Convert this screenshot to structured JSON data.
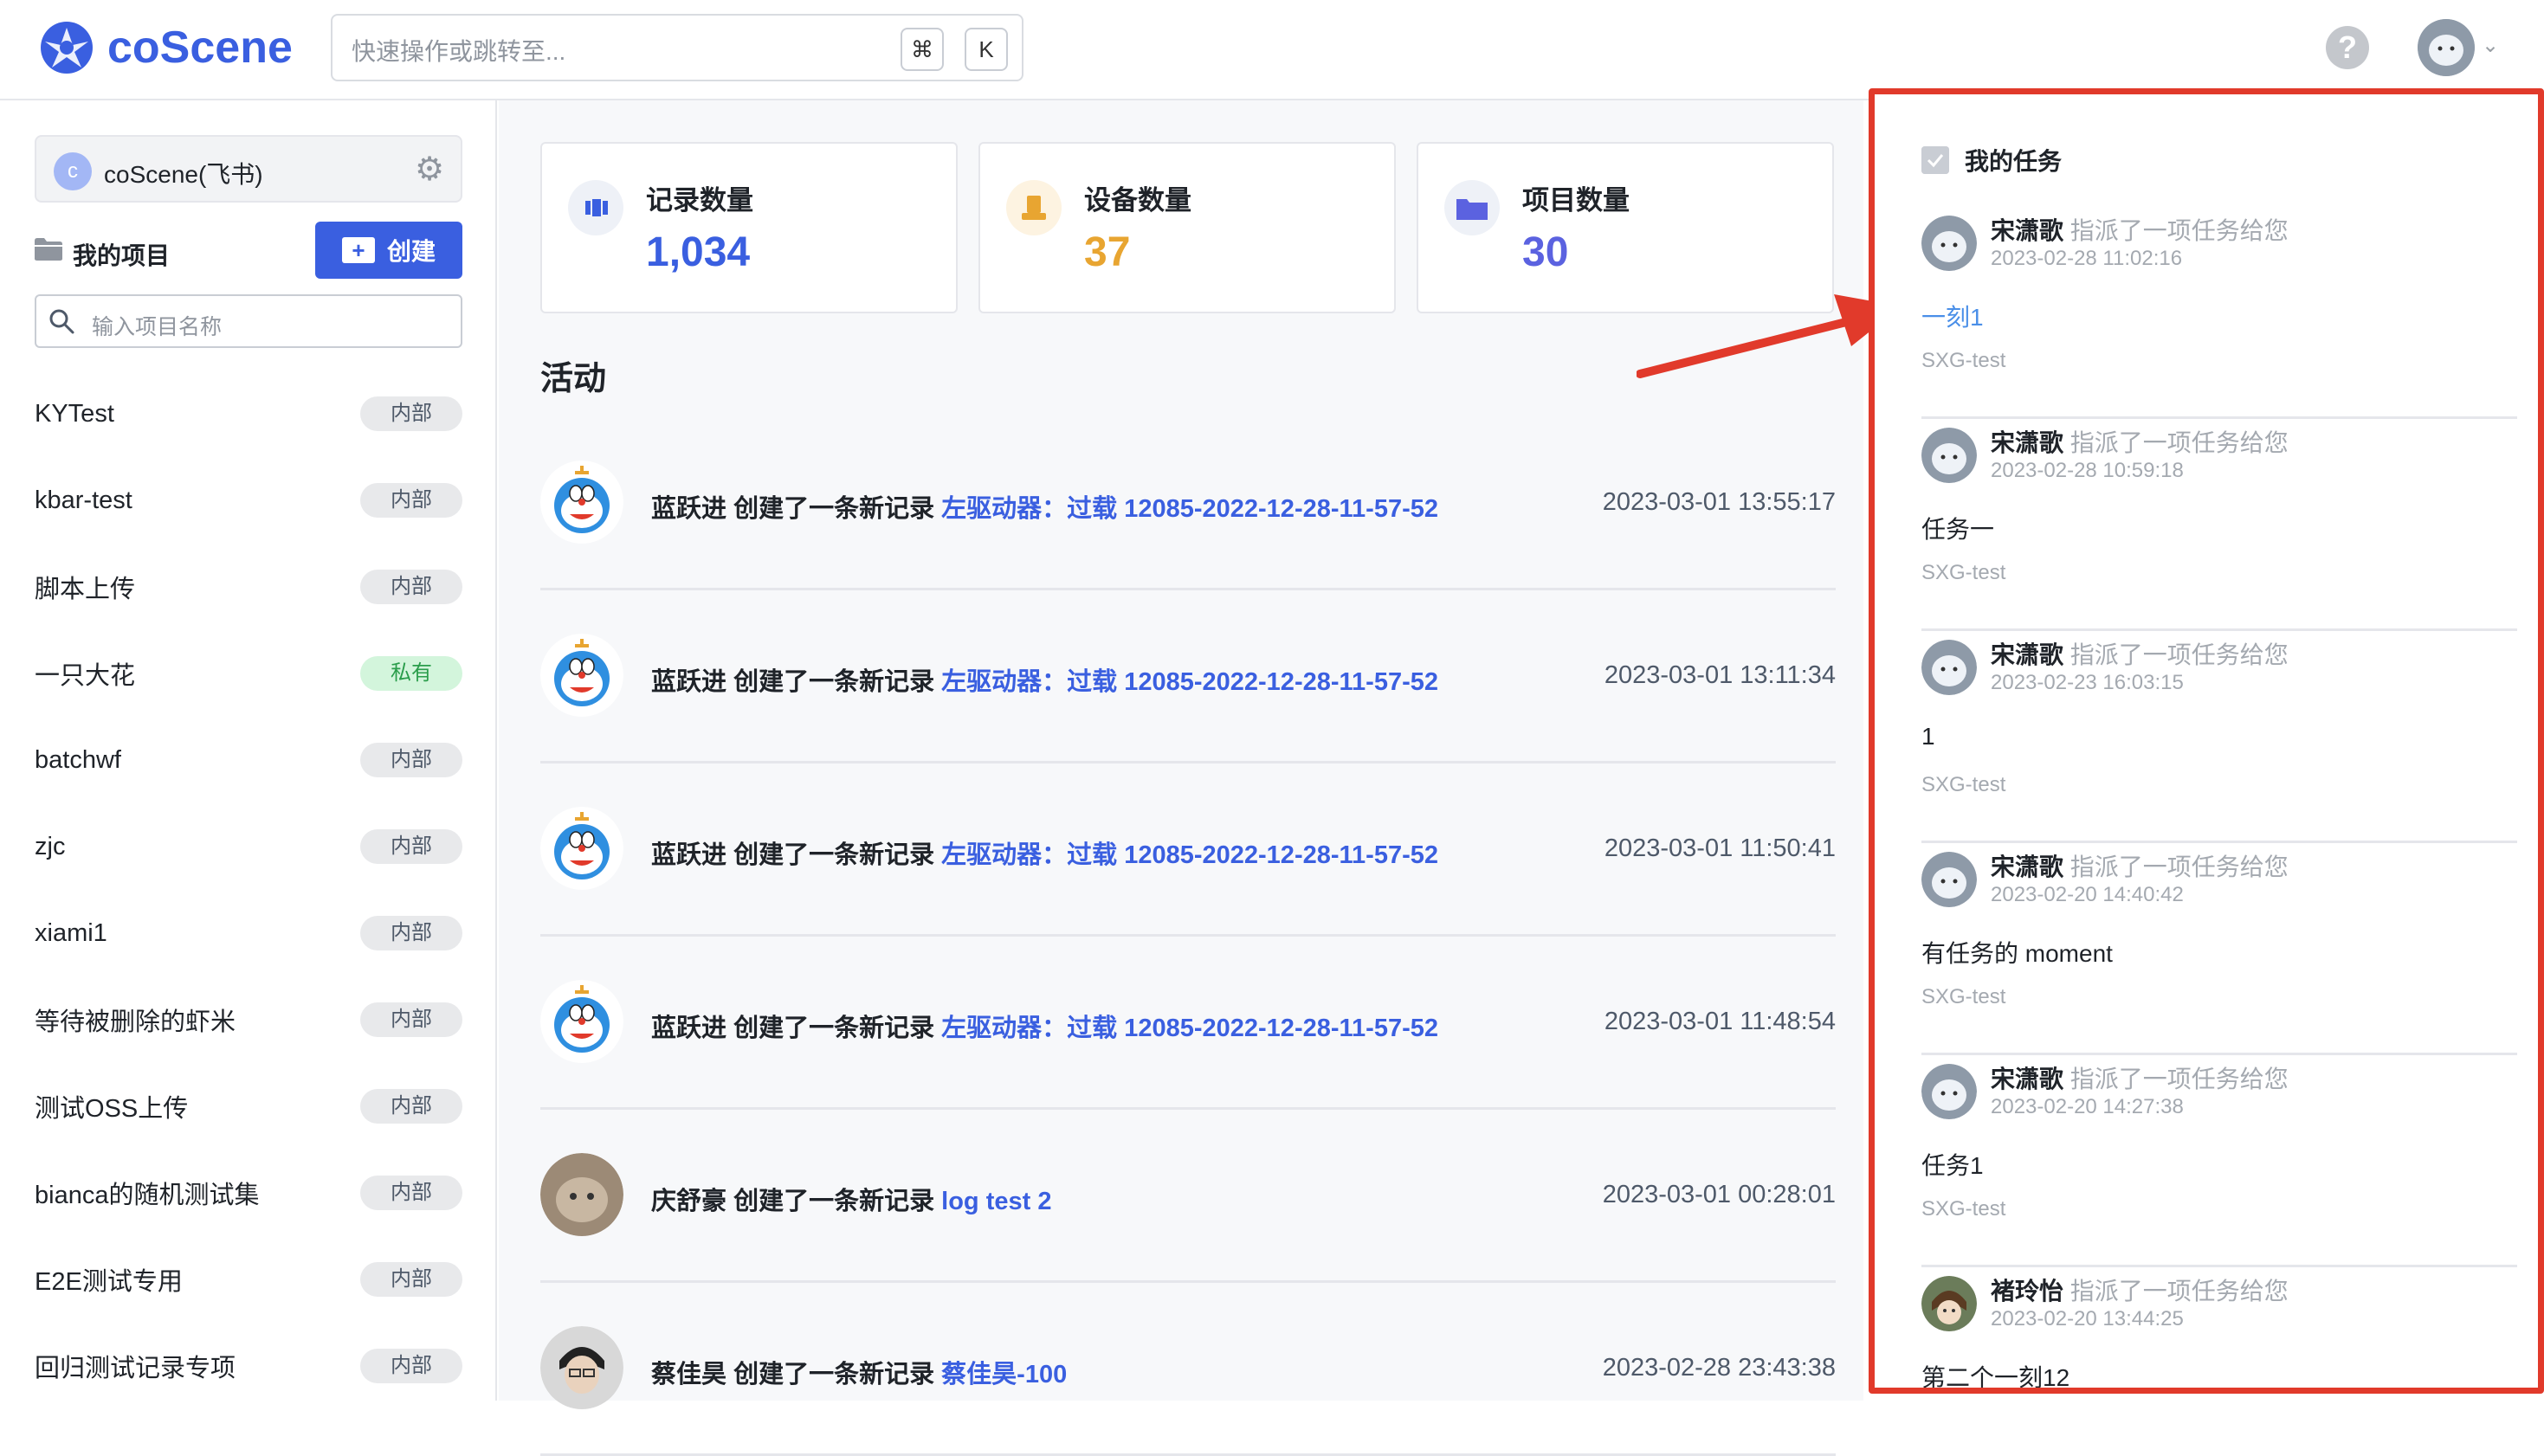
{
  "header": {
    "logo_text": "coScene",
    "search_placeholder": "快速操作或跳转至...",
    "shortcut_key_1": "⌘",
    "shortcut_key_2": "K",
    "help_label": "?"
  },
  "sidebar": {
    "org_avatar_letter": "c",
    "org_name": "coScene(飞书)",
    "my_projects_label": "我的项目",
    "create_button_label": "创建",
    "project_search_placeholder": "输入项目名称",
    "projects": [
      {
        "name": "KYTest",
        "badge": "内部"
      },
      {
        "name": "kbar-test",
        "badge": "内部"
      },
      {
        "name": "脚本上传",
        "badge": "内部"
      },
      {
        "name": "一只大花",
        "badge": "私有"
      },
      {
        "name": "batchwf",
        "badge": "内部"
      },
      {
        "name": "zjc",
        "badge": "内部"
      },
      {
        "name": "xiami1",
        "badge": "内部"
      },
      {
        "name": "等待被删除的虾米",
        "badge": "内部"
      },
      {
        "name": "测试OSS上传",
        "badge": "内部"
      },
      {
        "name": "bianca的随机测试集",
        "badge": "内部"
      },
      {
        "name": "E2E测试专用",
        "badge": "内部"
      },
      {
        "name": "回归测试记录专项",
        "badge": "内部"
      }
    ]
  },
  "stats": {
    "records": {
      "label": "记录数量",
      "value": "1,034",
      "color": "#3a5fe0"
    },
    "devices": {
      "label": "设备数量",
      "value": "37",
      "color": "#e8a531"
    },
    "projects": {
      "label": "项目数量",
      "value": "30",
      "color": "#5b62e0"
    }
  },
  "activity": {
    "title": "活动",
    "items": [
      {
        "user": "蓝跃进",
        "action": "创建了一条新记录",
        "target": "左驱动器：过载 12085-2022-12-28-11-57-52",
        "time": "2023-03-01 13:55:17"
      },
      {
        "user": "蓝跃进",
        "action": "创建了一条新记录",
        "target": "左驱动器：过载 12085-2022-12-28-11-57-52",
        "time": "2023-03-01 13:11:34"
      },
      {
        "user": "蓝跃进",
        "action": "创建了一条新记录",
        "target": "左驱动器：过载 12085-2022-12-28-11-57-52",
        "time": "2023-03-01 11:50:41"
      },
      {
        "user": "蓝跃进",
        "action": "创建了一条新记录",
        "target": "左驱动器：过载 12085-2022-12-28-11-57-52",
        "time": "2023-03-01 11:48:54"
      },
      {
        "user": "庆舒豪",
        "action": "创建了一条新记录",
        "target": "log test 2",
        "time": "2023-03-01 00:28:01"
      },
      {
        "user": "蔡佳昊",
        "action": "创建了一条新记录",
        "target": "蔡佳昊-100",
        "time": "2023-02-28 23:43:38"
      }
    ]
  },
  "tasks": {
    "title": "我的任务",
    "items": [
      {
        "user": "宋潇歌",
        "action": "指派了一项任务给您",
        "time": "2023-02-28 11:02:16",
        "title": "一刻1",
        "project": "SXG-test"
      },
      {
        "user": "宋潇歌",
        "action": "指派了一项任务给您",
        "time": "2023-02-28 10:59:18",
        "title": "任务一",
        "project": "SXG-test"
      },
      {
        "user": "宋潇歌",
        "action": "指派了一项任务给您",
        "time": "2023-02-23 16:03:15",
        "title": "1",
        "project": "SXG-test"
      },
      {
        "user": "宋潇歌",
        "action": "指派了一项任务给您",
        "time": "2023-02-20 14:40:42",
        "title": "有任务的 moment",
        "project": "SXG-test"
      },
      {
        "user": "宋潇歌",
        "action": "指派了一项任务给您",
        "time": "2023-02-20 14:27:38",
        "title": "任务1",
        "project": "SXG-test"
      },
      {
        "user": "褚玲怡",
        "action": "指派了一项任务给您",
        "time": "2023-02-20 13:44:25",
        "title": "第二个一刻12",
        "project": ""
      }
    ]
  },
  "colors": {
    "brand": "#3a5fe0",
    "highlight_border": "#e13a2b",
    "link": "#3a5fe0",
    "private_badge": "#d3f5dc"
  }
}
